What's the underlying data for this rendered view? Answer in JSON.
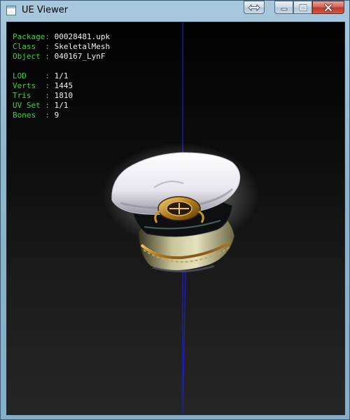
{
  "window": {
    "title": "UE Viewer",
    "icon": "app-window-icon",
    "controls": [
      "fit-icon",
      "minimize-icon",
      "maximize-icon",
      "close-icon"
    ],
    "colors": {
      "label": "#3cd33c",
      "value": "#f0f0f0",
      "axis": "#1e1ec8",
      "background": "#101010"
    }
  },
  "info": {
    "package": {
      "label": "Package:",
      "value": "00028481.upk"
    },
    "class": {
      "label": "Class  :",
      "value": "SkeletalMesh"
    },
    "object": {
      "label": "Object :",
      "value": "040167_LynF"
    },
    "lod": {
      "label": "LOD    :",
      "value": "1/1"
    },
    "verts": {
      "label": "Verts  :",
      "value": "1445"
    },
    "tris": {
      "label": "Tris   :",
      "value": "1810"
    },
    "uvset": {
      "label": "UV Set :",
      "value": "1/1"
    },
    "bones": {
      "label": "Bones  :",
      "value": "9"
    }
  }
}
